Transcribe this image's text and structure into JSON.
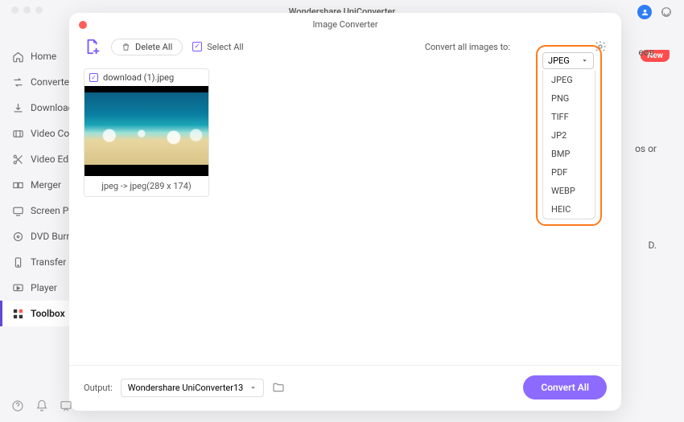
{
  "app": {
    "title": "Wondershare UniConverter"
  },
  "sidebar": {
    "items": [
      {
        "label": "Home"
      },
      {
        "label": "Converter"
      },
      {
        "label": "Downloader"
      },
      {
        "label": "Video Compressor"
      },
      {
        "label": "Video Editor"
      },
      {
        "label": "Merger"
      },
      {
        "label": "Screen Pair"
      },
      {
        "label": "DVD Burner"
      },
      {
        "label": "Transfer"
      },
      {
        "label": "Player"
      },
      {
        "label": "Toolbox"
      }
    ]
  },
  "modal": {
    "title": "Image Converter",
    "delete_all": "Delete All",
    "select_all": "Select All",
    "convert_to_label": "Convert all images to:",
    "format_selected": "JPEG",
    "formats": [
      "JPEG",
      "PNG",
      "TIFF",
      "JP2",
      "BMP",
      "PDF",
      "WEBP",
      "HEIC"
    ],
    "tile": {
      "filename": "download (1).jpeg",
      "status": "jpeg -> jpeg(289 x 174)"
    },
    "footer": {
      "output_label": "Output:",
      "output_path": "Wondershare UniConverter13",
      "convert_btn": "Convert All"
    }
  },
  "right_hints": [
    "eos.",
    "os or",
    "D."
  ],
  "badge_new": "New"
}
